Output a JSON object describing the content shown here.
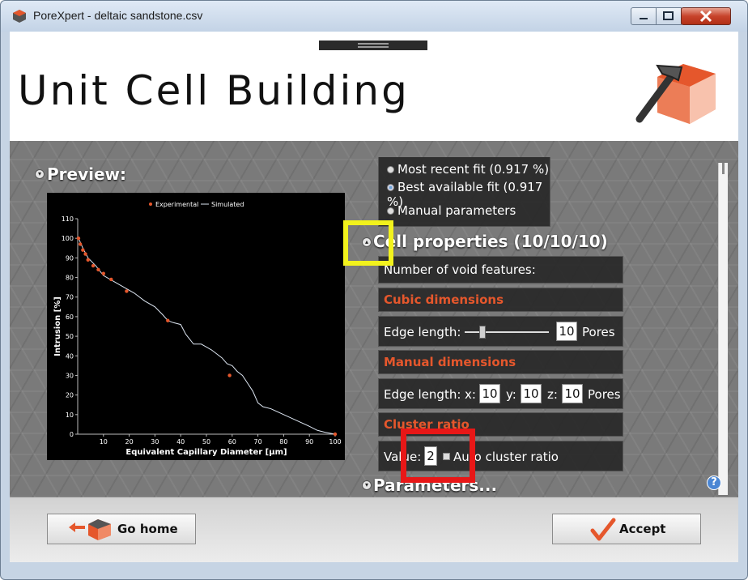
{
  "window": {
    "title": "PoreXpert - deltaic sandstone.csv"
  },
  "header": {
    "title": "Unit Cell Building"
  },
  "preview": {
    "title": "Preview:"
  },
  "chart_data": {
    "type": "scatter",
    "title": "",
    "xlabel": "Equivalent Capillary Diameter [µm]",
    "ylabel": "Intrusion [%]",
    "xlim": [
      0,
      100
    ],
    "ylim": [
      0,
      110
    ],
    "xticks": [
      "10",
      "20",
      "30",
      "40",
      "50",
      "60",
      "70",
      "80",
      "90",
      "100"
    ],
    "yticks": [
      "0",
      "10",
      "20",
      "30",
      "40",
      "50",
      "60",
      "70",
      "80",
      "90",
      "100",
      "110"
    ],
    "legend": {
      "placement": "top",
      "experimental": "Experimental",
      "simulated": "Simulated"
    },
    "series": [
      {
        "name": "Experimental",
        "mark": "points",
        "x": [
          0.3,
          1,
          2,
          3,
          4,
          6,
          8,
          10,
          13,
          19,
          35,
          59,
          100
        ],
        "y": [
          100,
          97,
          94,
          92,
          89,
          86,
          84,
          82,
          79,
          73,
          58,
          30,
          0
        ]
      },
      {
        "name": "Simulated",
        "mark": "line",
        "x": [
          0,
          2,
          4,
          7,
          10,
          14,
          18,
          22,
          26,
          30,
          33,
          35,
          37,
          40,
          42,
          45,
          48,
          52,
          56,
          58,
          60,
          62,
          64,
          66,
          68,
          70,
          72,
          75,
          80,
          85,
          90,
          93,
          96,
          100
        ],
        "y": [
          101,
          95,
          90,
          86,
          81,
          78,
          75,
          72,
          68,
          65,
          61,
          58,
          57,
          56,
          51,
          46,
          46,
          43,
          39,
          36,
          35,
          32,
          30,
          26,
          22,
          16,
          14,
          13,
          10,
          7,
          4,
          2,
          1,
          0
        ]
      }
    ]
  },
  "fit": {
    "options": [
      {
        "label": "Most recent fit (0.917 %)"
      },
      {
        "label": "Best available fit (0.917 %)"
      },
      {
        "label": "Manual parameters"
      }
    ]
  },
  "cell": {
    "title": "Cell properties (10/10/10)",
    "void_label": "Number of void features:",
    "cubic_head": "Cubic dimensions",
    "edge_label": "Edge length:",
    "edge_value": "10",
    "pores": "Pores",
    "manual_head": "Manual dimensions",
    "x_label": "x:",
    "x_value": "10",
    "y_label": "y:",
    "y_value": "10",
    "z_label": "z:",
    "z_value": "10",
    "cluster_head": "Cluster ratio",
    "value_label": "Value:",
    "cluster_value": "2",
    "auto_label": "Auto cluster ratio"
  },
  "parameters": {
    "title": "Parameters..."
  },
  "footer": {
    "home_label": "Go home",
    "accept_label": "Accept"
  },
  "colors": {
    "accent": "#e5572c",
    "highlight_yellow": "#f2f21c",
    "highlight_red": "#e81717"
  },
  "icons": {
    "help": "?"
  }
}
